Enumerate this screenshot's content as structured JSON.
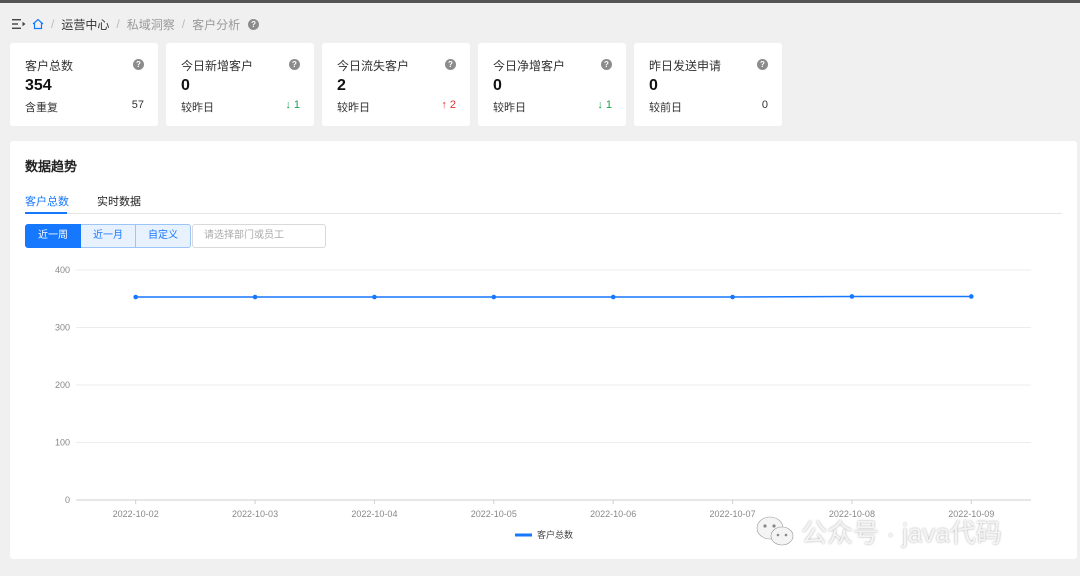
{
  "breadcrumb": {
    "items": [
      "运营中心",
      "私域洞察",
      "客户分析"
    ],
    "separator": "/"
  },
  "stats": [
    {
      "title": "客户总数",
      "value": "354",
      "foot_label": "含重复",
      "foot_value": "57",
      "trend": ""
    },
    {
      "title": "今日新增客户",
      "value": "0",
      "foot_label": "较昨日",
      "foot_value": "1",
      "trend": "down"
    },
    {
      "title": "今日流失客户",
      "value": "2",
      "foot_label": "较昨日",
      "foot_value": "2",
      "trend": "up"
    },
    {
      "title": "今日净增客户",
      "value": "0",
      "foot_label": "较昨日",
      "foot_value": "1",
      "trend": "down"
    },
    {
      "title": "昨日发送申请",
      "value": "0",
      "foot_label": "较前日",
      "foot_value": "0",
      "trend": ""
    }
  ],
  "panel": {
    "title": "数据趋势",
    "tabs": [
      "客户总数",
      "实时数据"
    ],
    "active_tab": 0,
    "range_buttons": [
      "近一周",
      "近一月",
      "自定义"
    ],
    "active_range": 0,
    "employee_select_placeholder": "请选择部门或员工"
  },
  "chart_data": {
    "type": "line",
    "x": [
      "2022-10-02",
      "2022-10-03",
      "2022-10-04",
      "2022-10-05",
      "2022-10-06",
      "2022-10-07",
      "2022-10-08",
      "2022-10-09"
    ],
    "series": [
      {
        "name": "客户总数",
        "values": [
          353,
          353,
          353,
          353,
          353,
          353,
          354,
          354
        ],
        "color": "#1677ff"
      }
    ],
    "ylim": [
      0,
      400
    ],
    "yticks": [
      0,
      100,
      200,
      300,
      400
    ],
    "grid": true,
    "legend": "bottom"
  },
  "watermark": {
    "text": "公众号 · java代码"
  },
  "colors": {
    "accent": "#1677ff",
    "down": "#1aa34a",
    "up": "#e03030"
  }
}
